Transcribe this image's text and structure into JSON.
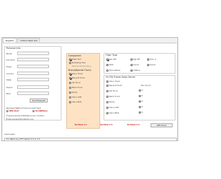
{
  "tabs": [
    "Register",
    "Online Flash List"
  ],
  "personal": {
    "title": "Personal Info",
    "fields": [
      "Name",
      "Surname",
      "Email",
      "Country",
      "State",
      "Userid",
      "Pass"
    ],
    "send_button": "Send Request",
    "payment_label": "Payment Method Online Credit Card",
    "payment_options": [
      "SMS Alert",
      "TechWithme"
    ],
    "footer_note": "If want payment Westernunion Contact",
    "email": "Email:support@outlook.com"
  },
  "component": {
    "title": "Component",
    "items": [
      {
        "label": "Flash Tool",
        "checked": true
      },
      {
        "label": "Bootstrap Tool",
        "checked": false
      },
      {
        "label": "Remote Programing",
        "checked": false
      }
    ]
  },
  "brand": {
    "title": "Brand(Normal Flash)",
    "items": [
      {
        "label": "Volvo Truck",
        "checked": true
      },
      {
        "label": "Renault Truck",
        "checked": true
      },
      {
        "label": "UD Truck",
        "checked": false
      },
      {
        "label": "Mack Truck",
        "checked": false
      },
      {
        "label": "Penta",
        "checked": false
      },
      {
        "label": "Volvo VCE",
        "checked": false
      },
      {
        "label": "Volvo BUS",
        "checked": false
      }
    ]
  },
  "flash_type": {
    "title": "Flash Type",
    "items": [
      {
        "label": "Sec.Off",
        "checked": true
      },
      {
        "label": "Egr.Off",
        "checked": false
      },
      {
        "label": "Euro 3",
        "checked": false
      },
      {
        "label": "DOS",
        "checked": false
      },
      {
        "label": "Euro2",
        "checked": false
      },
      {
        "label": "Euro5",
        "checked": false
      },
      {
        "label": "Hpa Adblue",
        "checked": false
      },
      {
        "label": "Adblue",
        "checked": false
      }
    ]
  },
  "online_flash": {
    "title": "On File Frame Volvo Server",
    "left": [
      "Volvo Truck",
      "Renault Truck",
      "UD Truck",
      "Mack Truck",
      "Penta",
      "Volvo VCE",
      "Volvo BUS"
    ],
    "file_count_label": "File Count",
    "right": [
      "0",
      "0",
      "0",
      "0",
      "0",
      "0"
    ]
  },
  "status": {
    "tech1": "Techtool 2.5",
    "tech2": "Techtool 2.5",
    "tech3": "Techtool 2.5",
    "sms_button": "SMS Done"
  },
  "info": {
    "label": "Information",
    "text": "You Need buy PTT Select 2.0 or 2.5"
  }
}
